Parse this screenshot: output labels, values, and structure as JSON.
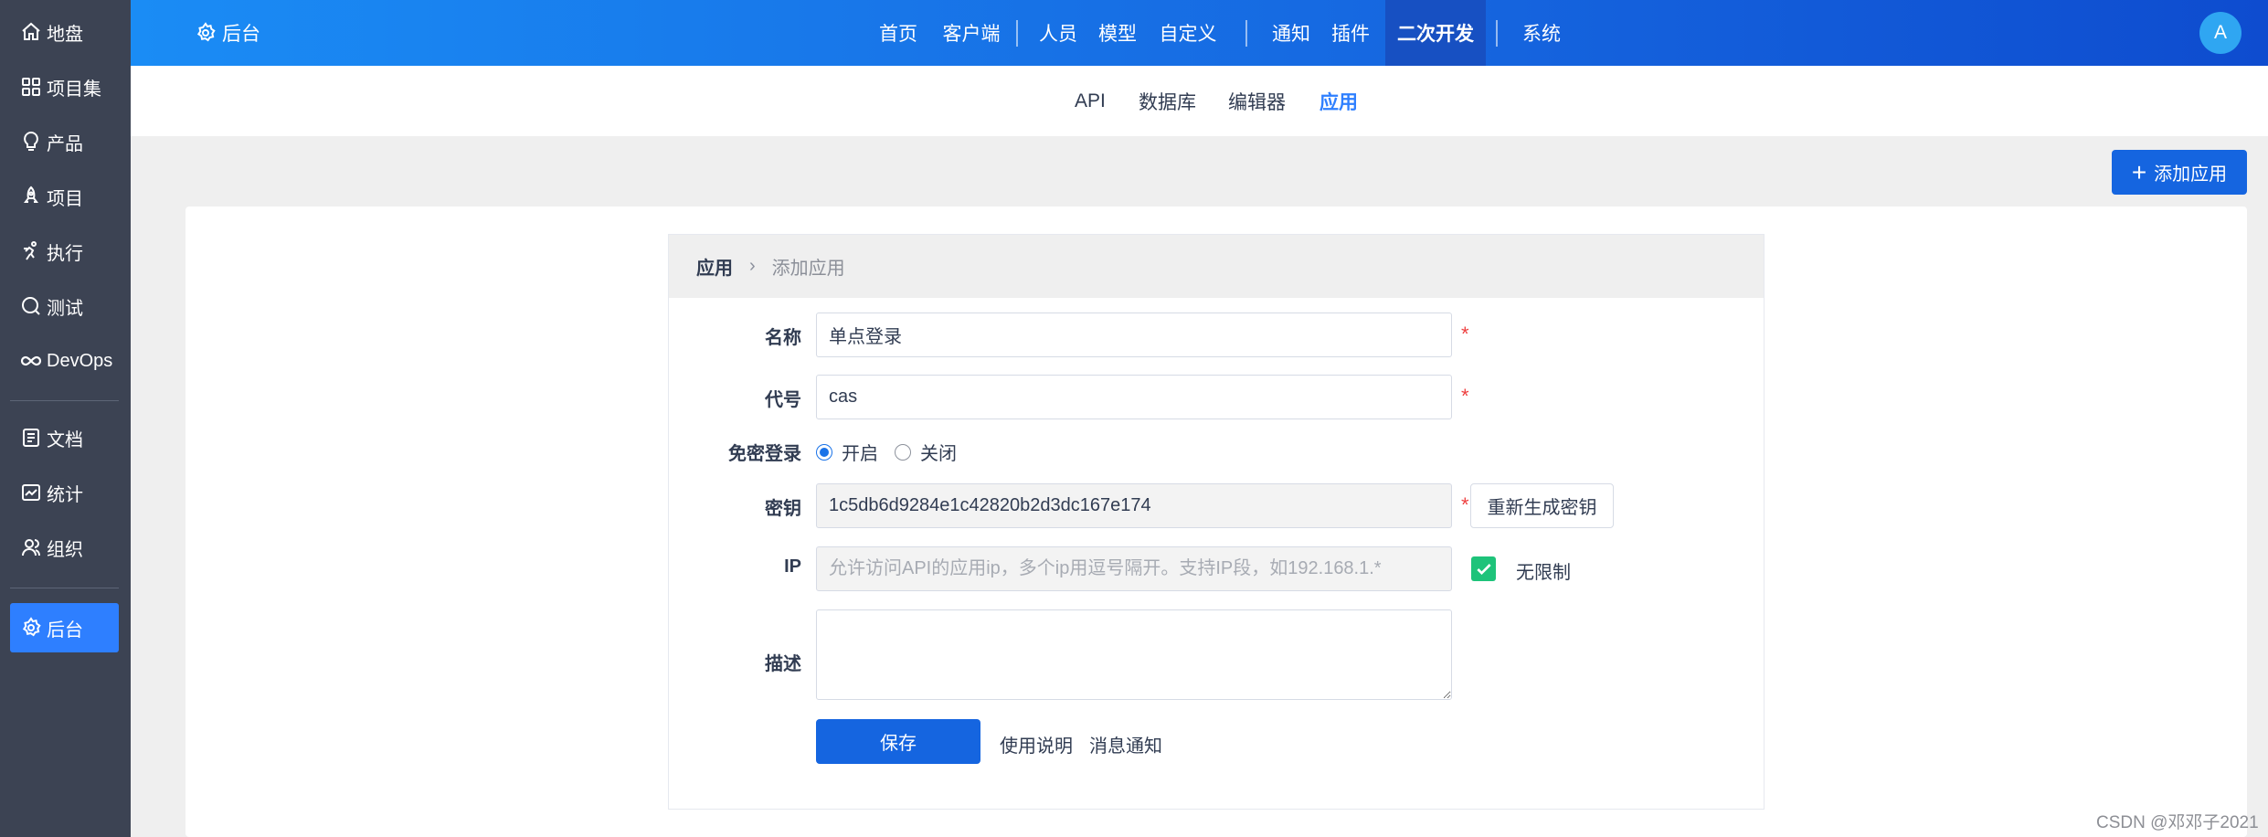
{
  "sidebar": {
    "items": [
      {
        "label": "地盘",
        "icon": "home-icon"
      },
      {
        "label": "项目集",
        "icon": "grid-icon"
      },
      {
        "label": "产品",
        "icon": "lightbulb-icon"
      },
      {
        "label": "项目",
        "icon": "rocket-icon"
      },
      {
        "label": "执行",
        "icon": "run-icon"
      },
      {
        "label": "测试",
        "icon": "search-icon"
      },
      {
        "label": "DevOps",
        "icon": "infinity-icon"
      },
      {
        "label": "文档",
        "icon": "document-icon"
      },
      {
        "label": "统计",
        "icon": "chart-icon"
      },
      {
        "label": "组织",
        "icon": "users-icon"
      },
      {
        "label": "后台",
        "icon": "gear-icon",
        "active": true
      }
    ]
  },
  "header": {
    "title": "后台",
    "nav": [
      "首页",
      "客户端",
      "人员",
      "模型",
      "自定义",
      "通知",
      "插件",
      "二次开发",
      "系统"
    ],
    "active_nav": "二次开发",
    "avatar": "A"
  },
  "subnav": {
    "items": [
      "API",
      "数据库",
      "编辑器",
      "应用"
    ],
    "active": "应用"
  },
  "actions": {
    "add_app": "添加应用"
  },
  "breadcrumb": {
    "main": "应用",
    "sub": "添加应用"
  },
  "form": {
    "name_label": "名称",
    "name_value": "单点登录",
    "code_label": "代号",
    "code_value": "cas",
    "login_label": "免密登录",
    "login_options": [
      "开启",
      "关闭"
    ],
    "login_selected": "开启",
    "key_label": "密钥",
    "key_value": "1c5db6d9284e1c42820b2d3dc167e174",
    "regen_label": "重新生成密钥",
    "ip_label": "IP",
    "ip_placeholder": "允许访问API的应用ip，多个ip用逗号隔开。支持IP段，如192.168.1.*",
    "unlimited_label": "无限制",
    "unlimited_checked": true,
    "desc_label": "描述",
    "desc_value": "",
    "required_mark": "*",
    "save_label": "保存",
    "help_link": "使用说明",
    "notify_link": "消息通知"
  },
  "watermark": "CSDN @邓邓子2021",
  "colors": {
    "sidebar_bg": "#3c4353",
    "primary": "#1565e0",
    "active_blue": "#2e7fff",
    "check_green": "#1ec37a",
    "required_red": "#ee4040"
  }
}
